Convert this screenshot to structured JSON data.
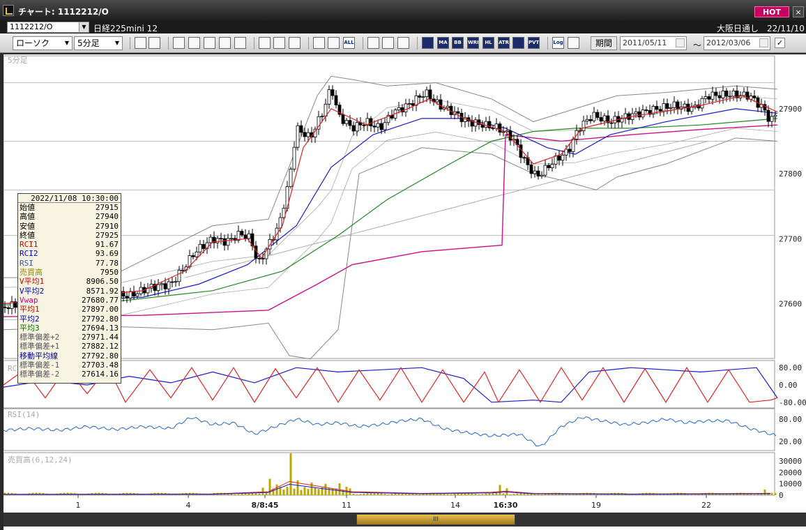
{
  "window": {
    "title": "チャート: 1112212/O",
    "hot_label": "HOT",
    "close_label": "×"
  },
  "symbol_bar": {
    "code": "1112212/O",
    "name": "日経225mini 12",
    "exchange_date": "大阪日通し　22/11/10"
  },
  "toolbar": {
    "chart_type": "ローソク",
    "interval": "5分足",
    "buttons": [
      "search",
      "cross",
      "multi",
      "zoom",
      "compare",
      "shift",
      "info",
      "pen",
      "cursor",
      "arrow",
      "candle",
      "candle2",
      "all",
      "tools",
      "draw",
      "color",
      "sma-a",
      "ma",
      "bb",
      "wre",
      "hl",
      "atr",
      "ea",
      "pvt",
      "log",
      "export"
    ],
    "button_labels": {
      "all": "ALL",
      "ma": "MA",
      "bb": "BB",
      "wre": "WRE",
      "hl": "HL",
      "atr": "ATR",
      "pvt": "PVT",
      "log": "Log"
    },
    "period_label": "期間",
    "date_from": "2011/05/11",
    "date_to": "2012/03/06",
    "tilde": "～",
    "check": "✓"
  },
  "panels": {
    "price": {
      "label": "5分足",
      "y_ticks": [
        "27900",
        "27800",
        "27700",
        "27600"
      ]
    },
    "rci": {
      "label": "RCI",
      "y_ticks": [
        "80.00",
        "0.00",
        "-80.00"
      ]
    },
    "rsi": {
      "label": "RSI(14)",
      "y_ticks": [
        "80.00",
        "20.00"
      ]
    },
    "volume": {
      "label": "売買高(6,12,24)",
      "y_ticks": [
        "30000",
        "20000",
        "10000",
        "0"
      ]
    }
  },
  "x_axis": {
    "labels": [
      {
        "text": "1",
        "bold": false
      },
      {
        "text": "4",
        "bold": false
      },
      {
        "text": "8/8:45",
        "bold": true
      },
      {
        "text": "11",
        "bold": false
      },
      {
        "text": "14",
        "bold": false
      },
      {
        "text": "16:30",
        "bold": true
      },
      {
        "text": "19",
        "bold": false
      },
      {
        "text": "22",
        "bold": false
      }
    ]
  },
  "databox": {
    "datetime": "2022/11/08 10:30:00",
    "rows": [
      {
        "label": "始値",
        "value": "27915",
        "color": "#000000"
      },
      {
        "label": "高値",
        "value": "27940",
        "color": "#000000"
      },
      {
        "label": "安値",
        "value": "27910",
        "color": "#000000"
      },
      {
        "label": "終値",
        "value": "27925",
        "color": "#000000"
      },
      {
        "label": "RCI1",
        "value": "91.67",
        "color": "#cc0000"
      },
      {
        "label": "RCI2",
        "value": "93.69",
        "color": "#0000cc"
      },
      {
        "label": "RSI",
        "value": "77.78",
        "color": "#3355aa"
      },
      {
        "label": "売買高",
        "value": "7950",
        "color": "#9a8a00"
      },
      {
        "label": "V平均1",
        "value": "8906.50",
        "color": "#cc0000"
      },
      {
        "label": "V平均2",
        "value": "8571.92",
        "color": "#0000cc"
      },
      {
        "label": "Vwap",
        "value": "27680.77",
        "color": "#cc0077"
      },
      {
        "label": "平均1",
        "value": "27897.00",
        "color": "#cc0000"
      },
      {
        "label": "平均2",
        "value": "27792.80",
        "color": "#0000cc"
      },
      {
        "label": "平均3",
        "value": "27694.13",
        "color": "#007700"
      },
      {
        "label": "標準偏差+2",
        "value": "27971.44",
        "color": "#555555"
      },
      {
        "label": "標準偏差+1",
        "value": "27882.12",
        "color": "#555555"
      },
      {
        "label": "移動平均線",
        "value": "27792.80",
        "color": "#0000aa"
      },
      {
        "label": "標準偏差-1",
        "value": "27703.48",
        "color": "#555555"
      },
      {
        "label": "標準偏差-2",
        "value": "27614.16",
        "color": "#555555"
      }
    ]
  },
  "scrollbar": {
    "thumb_label": "III"
  },
  "colors": {
    "up": "#ffffff",
    "down": "#000000",
    "ma1": "#dd2222",
    "ma2": "#1a1acc",
    "ma3": "#228822",
    "vwap": "#cc1188",
    "bands": "#888888",
    "rci1": "#dd2222",
    "rci2": "#1a1acc",
    "rsi": "#2266cc",
    "volume": "#b8a800"
  },
  "chart_data": {
    "type": "candlestick",
    "y_range": [
      27520,
      27975
    ],
    "reference_lines": [
      27940,
      27850,
      27775,
      27705
    ],
    "close_path": [
      [
        0,
        27595
      ],
      [
        30,
        27600
      ],
      [
        60,
        27605
      ],
      [
        90,
        27610
      ],
      [
        120,
        27605
      ],
      [
        150,
        27615
      ],
      [
        180,
        27612
      ],
      [
        210,
        27625
      ],
      [
        240,
        27630
      ],
      [
        255,
        27650
      ],
      [
        275,
        27680
      ],
      [
        300,
        27700
      ],
      [
        320,
        27695
      ],
      [
        340,
        27708
      ],
      [
        355,
        27700
      ],
      [
        365,
        27660
      ],
      [
        380,
        27690
      ],
      [
        395,
        27720
      ],
      [
        410,
        27790
      ],
      [
        420,
        27870
      ],
      [
        440,
        27855
      ],
      [
        460,
        27900
      ],
      [
        470,
        27935
      ],
      [
        480,
        27890
      ],
      [
        500,
        27870
      ],
      [
        520,
        27880
      ],
      [
        540,
        27870
      ],
      [
        560,
        27895
      ],
      [
        580,
        27905
      ],
      [
        605,
        27925
      ],
      [
        625,
        27905
      ],
      [
        645,
        27895
      ],
      [
        665,
        27880
      ],
      [
        690,
        27875
      ],
      [
        710,
        27870
      ],
      [
        730,
        27855
      ],
      [
        750,
        27815
      ],
      [
        765,
        27795
      ],
      [
        790,
        27820
      ],
      [
        810,
        27835
      ],
      [
        825,
        27870
      ],
      [
        845,
        27890
      ],
      [
        870,
        27880
      ],
      [
        900,
        27890
      ],
      [
        930,
        27898
      ],
      [
        960,
        27905
      ],
      [
        990,
        27900
      ],
      [
        1010,
        27920
      ],
      [
        1040,
        27922
      ],
      [
        1070,
        27920
      ],
      [
        1090,
        27900
      ],
      [
        1100,
        27880
      ],
      [
        1110,
        27895
      ]
    ],
    "ma1": [
      [
        0,
        27600
      ],
      [
        100,
        27610
      ],
      [
        200,
        27620
      ],
      [
        260,
        27650
      ],
      [
        300,
        27695
      ],
      [
        350,
        27700
      ],
      [
        370,
        27670
      ],
      [
        400,
        27720
      ],
      [
        430,
        27840
      ],
      [
        470,
        27900
      ],
      [
        520,
        27875
      ],
      [
        580,
        27900
      ],
      [
        610,
        27915
      ],
      [
        660,
        27885
      ],
      [
        720,
        27865
      ],
      [
        760,
        27815
      ],
      [
        800,
        27830
      ],
      [
        830,
        27870
      ],
      [
        900,
        27888
      ],
      [
        1000,
        27905
      ],
      [
        1060,
        27920
      ],
      [
        1110,
        27895
      ]
    ],
    "ma2": [
      [
        0,
        27600
      ],
      [
        100,
        27605
      ],
      [
        200,
        27610
      ],
      [
        280,
        27630
      ],
      [
        350,
        27660
      ],
      [
        420,
        27720
      ],
      [
        470,
        27810
      ],
      [
        530,
        27860
      ],
      [
        600,
        27885
      ],
      [
        660,
        27885
      ],
      [
        720,
        27870
      ],
      [
        780,
        27840
      ],
      [
        820,
        27830
      ],
      [
        870,
        27860
      ],
      [
        950,
        27880
      ],
      [
        1050,
        27900
      ],
      [
        1110,
        27893
      ]
    ],
    "ma3": [
      [
        0,
        27598
      ],
      [
        150,
        27602
      ],
      [
        300,
        27620
      ],
      [
        400,
        27650
      ],
      [
        480,
        27705
      ],
      [
        550,
        27760
      ],
      [
        640,
        27815
      ],
      [
        700,
        27850
      ],
      [
        760,
        27865
      ],
      [
        820,
        27870
      ],
      [
        900,
        27870
      ],
      [
        1000,
        27875
      ],
      [
        1110,
        27885
      ]
    ],
    "vwap": [
      [
        0,
        27580
      ],
      [
        200,
        27582
      ],
      [
        380,
        27590
      ],
      [
        450,
        27630
      ],
      [
        500,
        27660
      ],
      [
        600,
        27680
      ],
      [
        715,
        27690
      ],
      [
        720,
        27860
      ],
      [
        800,
        27850
      ],
      [
        900,
        27860
      ],
      [
        1000,
        27868
      ],
      [
        1110,
        27875
      ]
    ],
    "band_upper": [
      [
        0,
        27640
      ],
      [
        150,
        27640
      ],
      [
        300,
        27720
      ],
      [
        380,
        27730
      ],
      [
        450,
        27920
      ],
      [
        470,
        27950
      ],
      [
        500,
        27945
      ],
      [
        550,
        27935
      ],
      [
        620,
        27940
      ],
      [
        700,
        27915
      ],
      [
        760,
        27880
      ],
      [
        820,
        27900
      ],
      [
        880,
        27920
      ],
      [
        950,
        27925
      ],
      [
        1050,
        27935
      ],
      [
        1110,
        27930
      ]
    ],
    "band_lower": [
      [
        0,
        27560
      ],
      [
        150,
        27565
      ],
      [
        300,
        27560
      ],
      [
        380,
        27570
      ],
      [
        410,
        27520
      ],
      [
        440,
        27515
      ],
      [
        480,
        27560
      ],
      [
        510,
        27800
      ],
      [
        600,
        27840
      ],
      [
        700,
        27830
      ],
      [
        760,
        27800
      ],
      [
        800,
        27790
      ],
      [
        850,
        27775
      ],
      [
        880,
        27795
      ],
      [
        950,
        27815
      ],
      [
        1050,
        27855
      ],
      [
        1110,
        27850
      ]
    ],
    "trendline": [
      [
        260,
        27640
      ],
      [
        1010,
        27850
      ]
    ],
    "rci1": [
      [
        0,
        0
      ],
      [
        30,
        70
      ],
      [
        60,
        -60
      ],
      [
        90,
        80
      ],
      [
        120,
        -40
      ],
      [
        150,
        80
      ],
      [
        175,
        -80
      ],
      [
        210,
        70
      ],
      [
        240,
        -60
      ],
      [
        270,
        80
      ],
      [
        300,
        -70
      ],
      [
        330,
        80
      ],
      [
        360,
        -80
      ],
      [
        390,
        75
      ],
      [
        420,
        -60
      ],
      [
        450,
        80
      ],
      [
        480,
        -80
      ],
      [
        510,
        70
      ],
      [
        540,
        -70
      ],
      [
        570,
        80
      ],
      [
        600,
        -80
      ],
      [
        630,
        70
      ],
      [
        660,
        -80
      ],
      [
        690,
        60
      ],
      [
        710,
        -80
      ],
      [
        740,
        70
      ],
      [
        770,
        -80
      ],
      [
        800,
        80
      ],
      [
        830,
        -70
      ],
      [
        860,
        80
      ],
      [
        890,
        -80
      ],
      [
        920,
        75
      ],
      [
        950,
        -80
      ],
      [
        980,
        80
      ],
      [
        1010,
        -80
      ],
      [
        1040,
        70
      ],
      [
        1070,
        -80
      ],
      [
        1100,
        -70
      ],
      [
        1110,
        -60
      ]
    ],
    "rci2": [
      [
        0,
        -10
      ],
      [
        60,
        20
      ],
      [
        120,
        0
      ],
      [
        180,
        40
      ],
      [
        240,
        10
      ],
      [
        300,
        60
      ],
      [
        360,
        10
      ],
      [
        420,
        80
      ],
      [
        480,
        60
      ],
      [
        540,
        70
      ],
      [
        600,
        80
      ],
      [
        660,
        30
      ],
      [
        700,
        -80
      ],
      [
        760,
        -70
      ],
      [
        800,
        -80
      ],
      [
        840,
        60
      ],
      [
        900,
        80
      ],
      [
        1000,
        60
      ],
      [
        1080,
        80
      ],
      [
        1110,
        -60
      ]
    ],
    "rsi": [
      [
        0,
        50
      ],
      [
        40,
        55
      ],
      [
        80,
        50
      ],
      [
        120,
        60
      ],
      [
        160,
        52
      ],
      [
        200,
        60
      ],
      [
        240,
        55
      ],
      [
        270,
        85
      ],
      [
        300,
        65
      ],
      [
        330,
        70
      ],
      [
        360,
        40
      ],
      [
        390,
        60
      ],
      [
        420,
        80
      ],
      [
        450,
        65
      ],
      [
        480,
        70
      ],
      [
        510,
        60
      ],
      [
        540,
        65
      ],
      [
        570,
        75
      ],
      [
        600,
        80
      ],
      [
        630,
        55
      ],
      [
        660,
        45
      ],
      [
        700,
        35
      ],
      [
        740,
        40
      ],
      [
        770,
        5
      ],
      [
        800,
        60
      ],
      [
        830,
        85
      ],
      [
        860,
        75
      ],
      [
        890,
        65
      ],
      [
        920,
        70
      ],
      [
        950,
        80
      ],
      [
        980,
        70
      ],
      [
        1010,
        75
      ],
      [
        1040,
        75
      ],
      [
        1070,
        55
      ],
      [
        1100,
        40
      ],
      [
        1110,
        35
      ]
    ],
    "volume_spikes": [
      [
        380,
        9000
      ],
      [
        390,
        5000
      ],
      [
        410,
        33000
      ],
      [
        420,
        8000
      ],
      [
        440,
        6000
      ],
      [
        460,
        7000
      ],
      [
        480,
        5000
      ],
      [
        710,
        9000
      ],
      [
        720,
        6000
      ],
      [
        1090,
        5000
      ]
    ],
    "volume_ma": [
      [
        0,
        800
      ],
      [
        300,
        1000
      ],
      [
        380,
        3000
      ],
      [
        410,
        12000
      ],
      [
        450,
        8000
      ],
      [
        500,
        3000
      ],
      [
        600,
        1500
      ],
      [
        700,
        2500
      ],
      [
        720,
        3500
      ],
      [
        760,
        1500
      ],
      [
        900,
        1000
      ],
      [
        1100,
        1500
      ]
    ]
  }
}
